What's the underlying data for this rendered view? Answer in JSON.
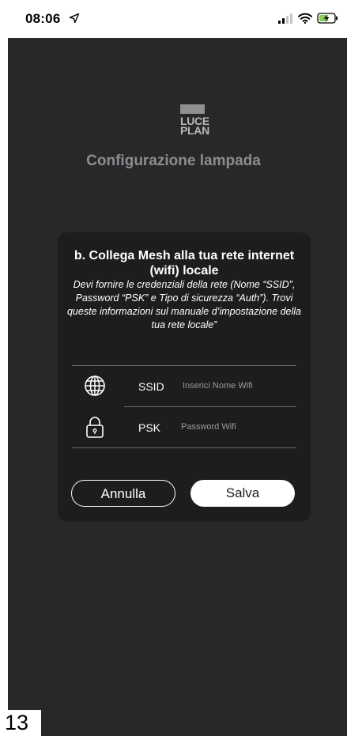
{
  "status_bar": {
    "time": "08:06",
    "icons": [
      "location-arrow-icon",
      "signal-icon",
      "wifi-icon",
      "battery-charging-icon"
    ]
  },
  "brand": {
    "logo_line1": "LUCE",
    "logo_line2": "PLAN"
  },
  "screen_title": "Configurazione lampada",
  "dialog": {
    "heading": "b. Collega Mesh alla tua rete internet (wifi) locale",
    "description": "Devi fornire le credenziali della rete (Nome “SSID”, Password “PSK” e Tipo di sicurezza “Auth”). Trovi queste informazioni sul manuale d’impostazione della tua rete locale”",
    "fields": [
      {
        "label": "SSID",
        "value": "",
        "placeholder": "Inserici Nome Wifi",
        "icon": "globe-icon"
      },
      {
        "label": "PSK",
        "value": "",
        "placeholder": "Password Wifi",
        "icon": "lock-icon"
      }
    ],
    "cancel_label": "Annulla",
    "save_label": "Salva"
  },
  "page_number": "13",
  "colors": {
    "screen_bg": "#28282a",
    "dialog_bg": "#1d1d1f",
    "title_text": "#8d8d90",
    "divider": "#6c6c6e"
  }
}
